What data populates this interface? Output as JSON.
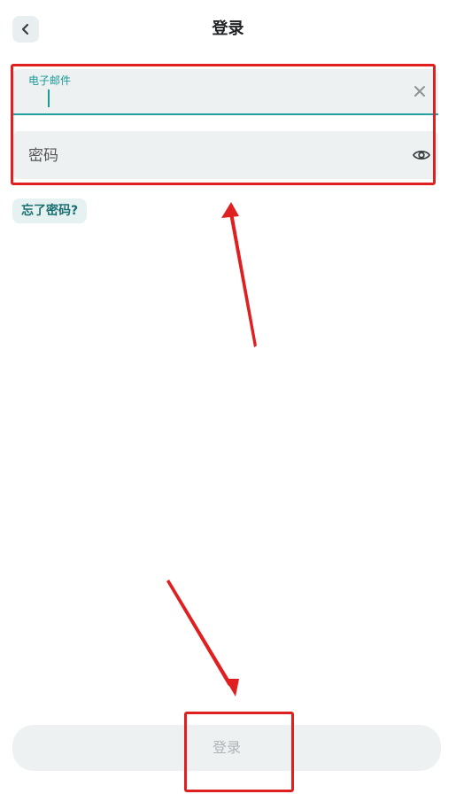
{
  "header": {
    "title": "登录",
    "back_icon": "chevron-left-icon"
  },
  "form": {
    "email": {
      "label": "电子邮件",
      "value": "",
      "clear_icon": "close-icon"
    },
    "password": {
      "placeholder": "密码",
      "toggle_icon": "eye-icon"
    },
    "forgot_password_label": "忘了密码?"
  },
  "footer": {
    "login_label": "登录"
  },
  "colors": {
    "accent": "#1a9a98",
    "annotation": "#e02020",
    "field_bg": "#eef1f2"
  }
}
